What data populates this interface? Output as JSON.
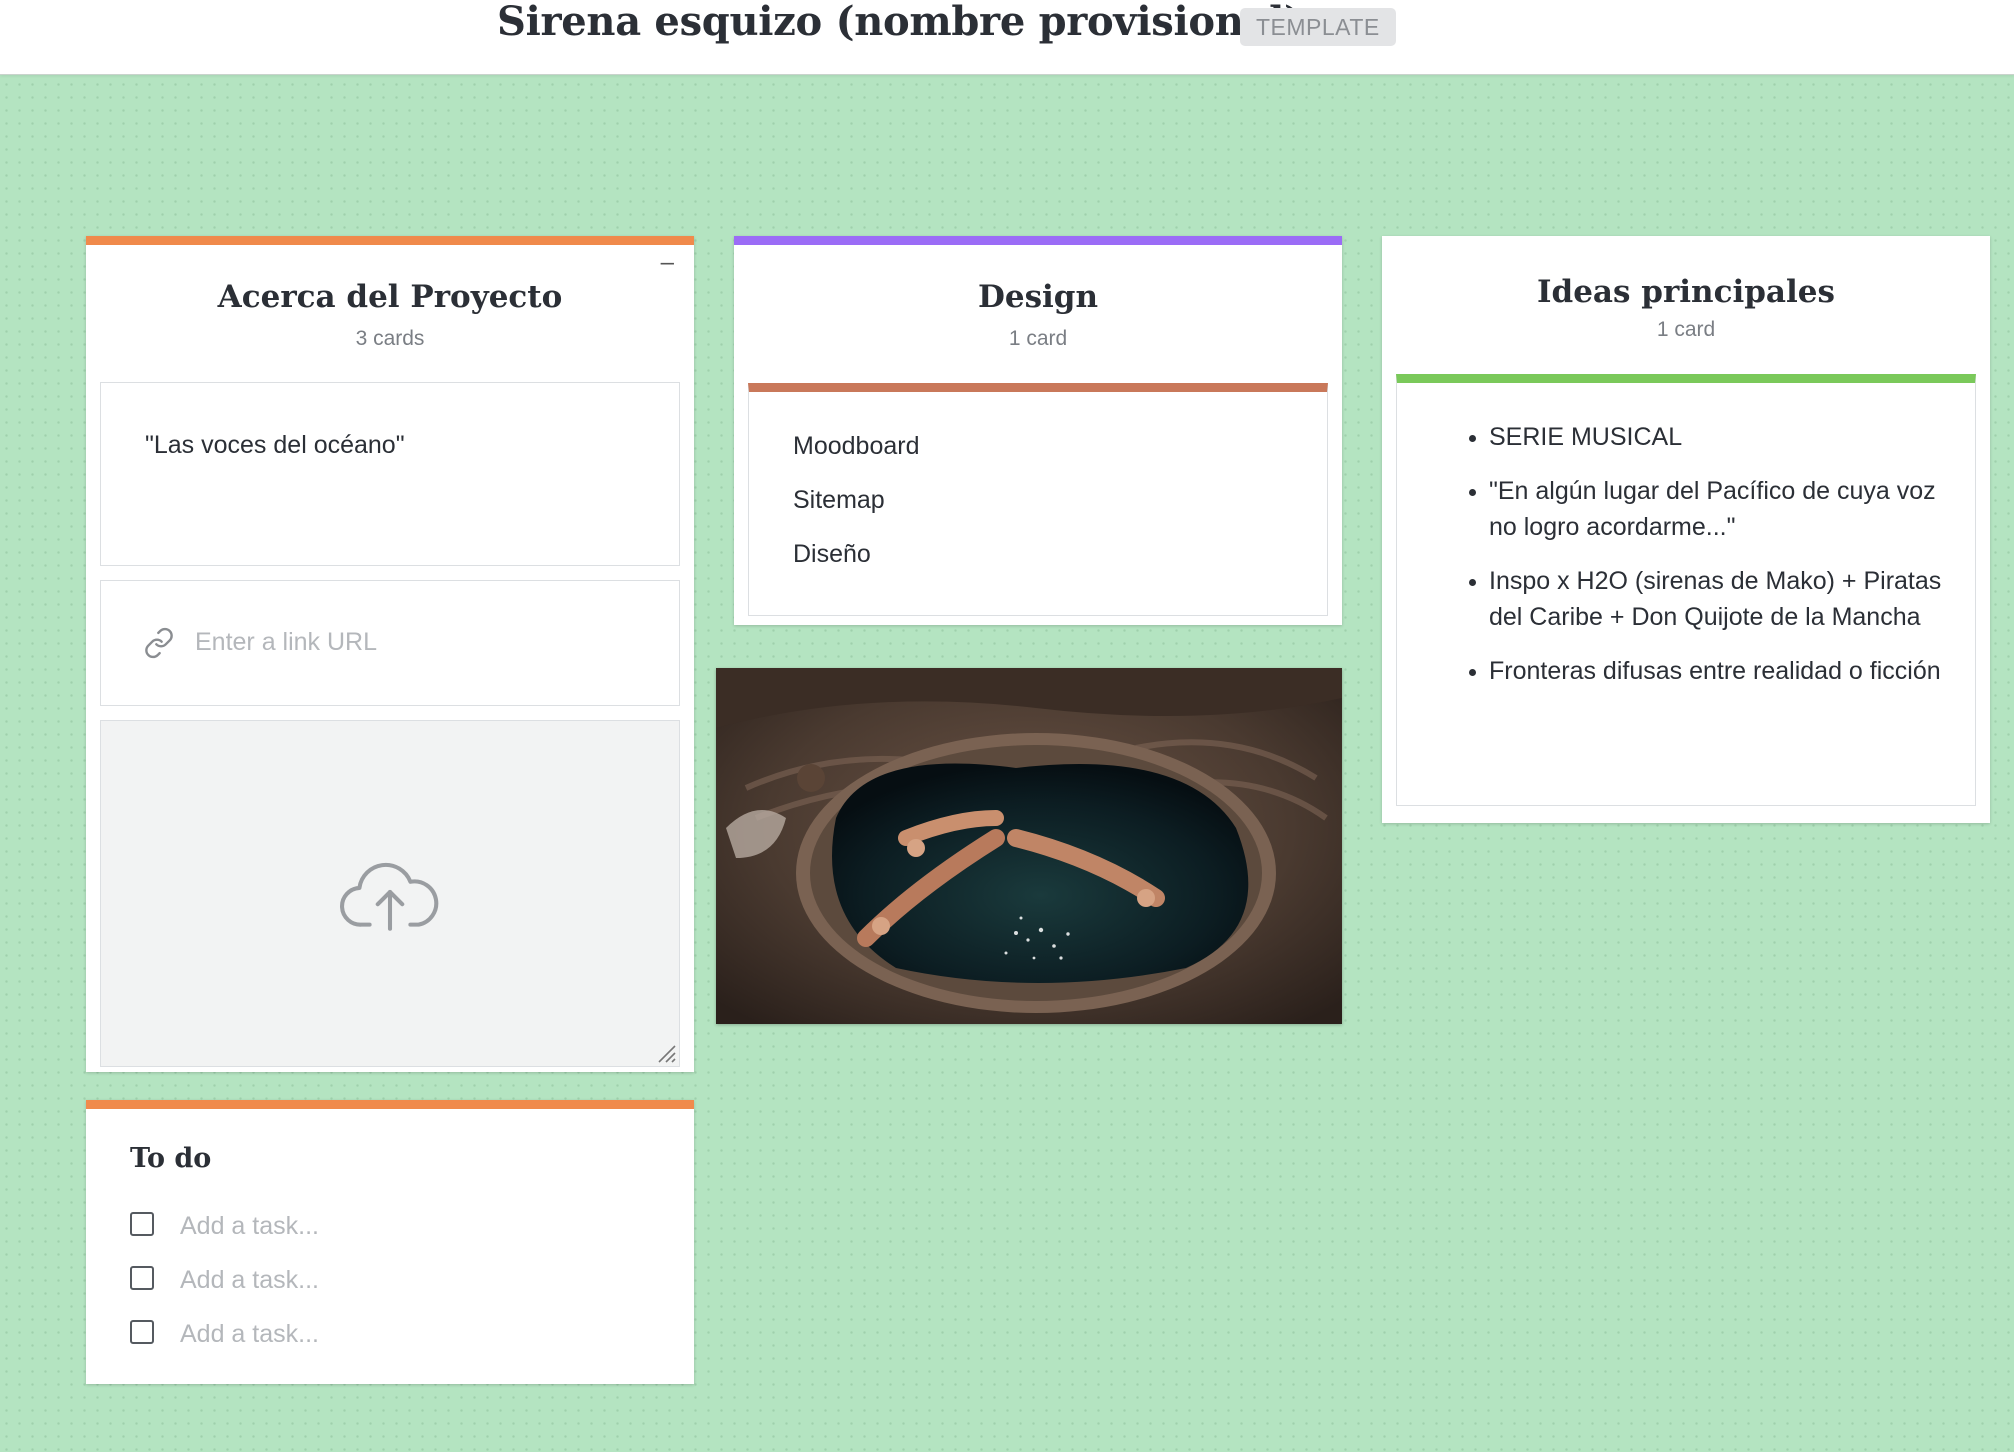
{
  "board": {
    "title": "Sirena esquizo (nombre provisional)",
    "badge": "TEMPLATE"
  },
  "columns": {
    "about": {
      "title": "Acerca del Proyecto",
      "count": "3 cards",
      "accent": "#f08a4b",
      "minimize_icon": "minus-icon",
      "note_text": "\"Las voces del océano\"",
      "link_placeholder": "Enter a link URL",
      "link_icon": "link-icon",
      "upload_icon": "cloud-upload-icon"
    },
    "design": {
      "title": "Design",
      "count": "1 card",
      "accent": "#9b6cf6",
      "card_accent": "#c9785a",
      "items": [
        "Moodboard",
        "Sitemap",
        "Diseño"
      ]
    },
    "ideas": {
      "title": "Ideas principales",
      "count": "1 card",
      "card_accent": "#7ac95a",
      "items": [
        "SERIE MUSICAL",
        "\"En algún lugar del Pacífico de cuya voz no logro acordarme...\"",
        "Inspo x H2O (sirenas de Mako) + Piratas del Caribe + Don Quijote de la Mancha",
        "Fronteras difusas entre realidad o ficción"
      ]
    },
    "todo": {
      "title": "To do",
      "accent": "#f08a4b",
      "task_placeholder": "Add a task..."
    }
  },
  "image": {
    "description_icon": "mermaid-pool-image"
  },
  "colors": {
    "background": "#b4e4c1",
    "text": "#2b2f36"
  }
}
